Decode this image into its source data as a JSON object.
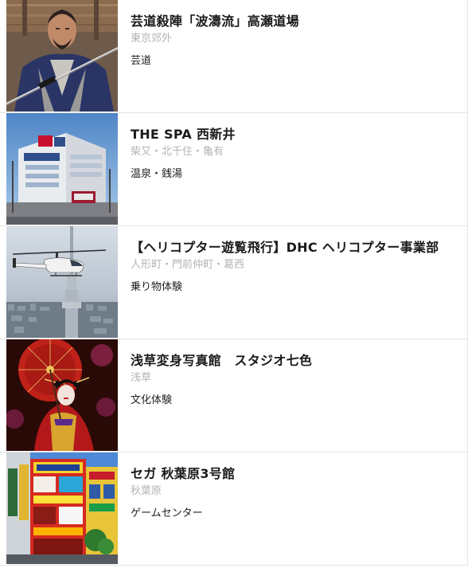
{
  "items": [
    {
      "title": "芸道殺陣「波濤流」高瀬道場",
      "area": "東京郊外",
      "category": "芸道",
      "image": "samurai-master-photo"
    },
    {
      "title": "THE SPA 西新井",
      "area": "柴又・北千住・亀有",
      "category": "温泉・銭湯",
      "image": "spa-building-photo"
    },
    {
      "title": "【ヘリコプター遊覧飛行】DHC ヘリコプター事業部",
      "area": "人形町・門前仲町・葛西",
      "category": "乗り物体験",
      "image": "helicopter-photo"
    },
    {
      "title": "浅草変身写真館　スタジオ七色",
      "area": "浅草",
      "category": "文化体験",
      "image": "oiran-photo"
    },
    {
      "title": "セガ 秋葉原3号館",
      "area": "秋葉原",
      "category": "ゲームセンター",
      "image": "akihabara-arcade-photo"
    }
  ]
}
